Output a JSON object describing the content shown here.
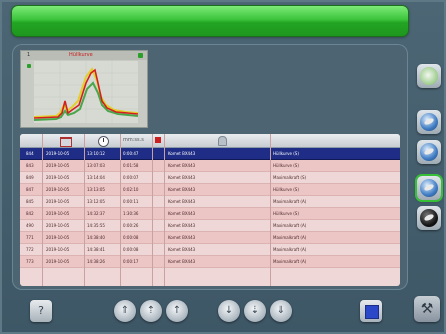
{
  "chart": {
    "number": "1",
    "title": "Hüllkurve"
  },
  "table": {
    "header_duration": "mm:ss.s",
    "rows": [
      {
        "id": "844",
        "date": "2019-10-05",
        "time": "13:10:12",
        "dur": "0:00:47",
        "name": "Komet BX443",
        "type": "Hüllkurve (S)",
        "selected": true
      },
      {
        "id": "843",
        "date": "2019-10-05",
        "time": "13:07:03",
        "dur": "0:01:58",
        "name": "Komet BX443",
        "type": "Hüllkurve (S)",
        "selected": false
      },
      {
        "id": "849",
        "date": "2019-10-05",
        "time": "13:14:04",
        "dur": "0:00:07",
        "name": "Komet BX443",
        "type": "Maximalkraft (S)",
        "selected": false
      },
      {
        "id": "847",
        "date": "2019-10-05",
        "time": "13:13:05",
        "dur": "0:02:10",
        "name": "Komet BX443",
        "type": "Hüllkurve (S)",
        "selected": false
      },
      {
        "id": "845",
        "date": "2019-10-05",
        "time": "13:12:05",
        "dur": "0:00:11",
        "name": "Komet BX443",
        "type": "Maximalkraft (A)",
        "selected": false
      },
      {
        "id": "842",
        "date": "2019-10-05",
        "time": "14:32:37",
        "dur": "1:30:36",
        "name": "Komet BX443",
        "type": "Hüllkurve (S)",
        "selected": false
      },
      {
        "id": "490",
        "date": "2019-10-05",
        "time": "14:35:55",
        "dur": "0:00:26",
        "name": "Komet BX443",
        "type": "Maximalkraft (A)",
        "selected": false
      },
      {
        "id": "771",
        "date": "2019-10-05",
        "time": "14:38:40",
        "dur": "0:00:08",
        "name": "Komet BX443",
        "type": "Maximalkraft (A)",
        "selected": false
      },
      {
        "id": "772",
        "date": "2019-10-05",
        "time": "14:38:41",
        "dur": "0:00:08",
        "name": "Komet BX443",
        "type": "Maximalkraft (A)",
        "selected": false
      },
      {
        "id": "773",
        "date": "2019-10-05",
        "time": "14:38:26",
        "dur": "0:00:17",
        "name": "Komet BX443",
        "type": "Maximalkraft (A)",
        "selected": false
      }
    ]
  },
  "bottom": {
    "info_glyph": "?",
    "up_glyphs": [
      "⇑",
      "⇡",
      "↑"
    ],
    "down_glyphs": [
      "↓",
      "⇣",
      "⇓"
    ],
    "tools_glyph": "⚒"
  },
  "colors": {
    "accent_green": "#3cc43c",
    "selection_blue": "#1f2d86",
    "row_pink": "#f0d7d7"
  }
}
